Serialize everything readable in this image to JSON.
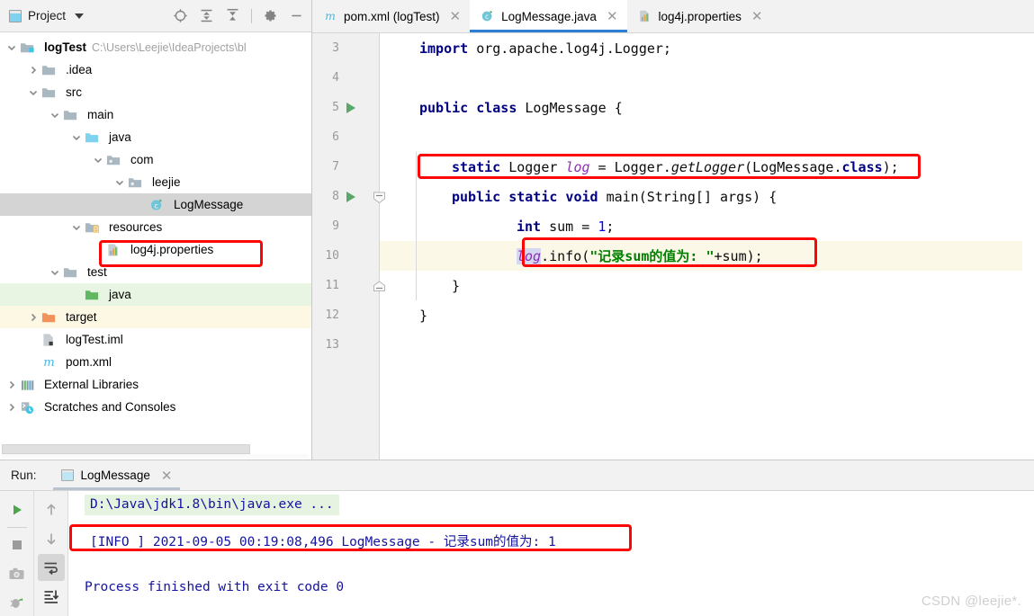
{
  "project_panel": {
    "title": "Project",
    "window_icon": "project-window-icon",
    "toolbar": [
      {
        "name": "locate-icon",
        "tooltip": "Select Opened File"
      },
      {
        "name": "expand-all-icon",
        "tooltip": "Expand All"
      },
      {
        "name": "collapse-all-icon",
        "tooltip": "Collapse All"
      },
      {
        "name": "settings-gear-icon",
        "tooltip": "Settings"
      },
      {
        "name": "hide-icon",
        "tooltip": "Hide"
      }
    ],
    "tree": [
      {
        "label": "logTest",
        "path": "C:\\Users\\Leejie\\IdeaProjects\\bl",
        "icon": "module-folder-icon",
        "arrow": "expanded",
        "depth": 0,
        "bold": true
      },
      {
        "label": ".idea",
        "path": "",
        "icon": "folder-icon",
        "arrow": "collapsed",
        "depth": 1,
        "bold": false
      },
      {
        "label": "src",
        "path": "",
        "icon": "folder-icon",
        "arrow": "expanded",
        "depth": 1,
        "bold": false
      },
      {
        "label": "main",
        "path": "",
        "icon": "folder-icon",
        "arrow": "expanded",
        "depth": 2,
        "bold": false
      },
      {
        "label": "java",
        "path": "",
        "icon": "source-root-folder-icon",
        "arrow": "expanded",
        "depth": 3,
        "bold": false
      },
      {
        "label": "com",
        "path": "",
        "icon": "package-icon",
        "arrow": "expanded",
        "depth": 4,
        "bold": false
      },
      {
        "label": "leejie",
        "path": "",
        "icon": "package-icon",
        "arrow": "expanded",
        "depth": 5,
        "bold": false
      },
      {
        "label": "LogMessage",
        "path": "",
        "icon": "java-class-icon",
        "arrow": "none",
        "depth": 6,
        "bold": false,
        "state": "selected"
      },
      {
        "label": "resources",
        "path": "",
        "icon": "resources-folder-icon",
        "arrow": "expanded",
        "depth": 3,
        "bold": false
      },
      {
        "label": "log4j.properties",
        "path": "",
        "icon": "properties-file-icon",
        "arrow": "none",
        "depth": 4,
        "bold": false,
        "state": "highlighted"
      },
      {
        "label": "test",
        "path": "",
        "icon": "folder-icon",
        "arrow": "expanded",
        "depth": 2,
        "bold": false
      },
      {
        "label": "java",
        "path": "",
        "icon": "test-source-folder-icon",
        "arrow": "none",
        "depth": 3,
        "bold": false,
        "state": "green"
      },
      {
        "label": "target",
        "path": "",
        "icon": "excluded-folder-icon",
        "arrow": "collapsed",
        "depth": 1,
        "bold": false,
        "state": "yellow"
      },
      {
        "label": "logTest.iml",
        "path": "",
        "icon": "iml-file-icon",
        "arrow": "none",
        "depth": 1,
        "bold": false
      },
      {
        "label": "pom.xml",
        "path": "",
        "icon": "maven-file-icon",
        "arrow": "none",
        "depth": 1,
        "bold": false
      },
      {
        "label": "External Libraries",
        "path": "",
        "icon": "libraries-icon",
        "arrow": "collapsed",
        "depth": 0,
        "bold": false
      },
      {
        "label": "Scratches and Consoles",
        "path": "",
        "icon": "scratches-icon",
        "arrow": "collapsed",
        "depth": 0,
        "bold": false
      }
    ]
  },
  "editor": {
    "tabs": [
      {
        "label": "pom.xml (logTest)",
        "icon": "maven-file-icon",
        "active": false,
        "closable": true
      },
      {
        "label": "LogMessage.java",
        "icon": "java-class-icon",
        "active": true,
        "closable": true
      },
      {
        "label": "log4j.properties",
        "icon": "properties-file-icon",
        "active": false,
        "closable": true
      }
    ],
    "lines": [
      {
        "num": "3",
        "gutter": "none",
        "current": false,
        "tokens": [
          {
            "t": "import ",
            "c": "kw"
          },
          {
            "t": "org.apache.log4j.Logger;",
            "c": "plain"
          }
        ],
        "indent": 4
      },
      {
        "num": "4",
        "gutter": "none",
        "current": false,
        "tokens": [],
        "indent": 0
      },
      {
        "num": "5",
        "gutter": "run",
        "current": false,
        "tokens": [
          {
            "t": "public class ",
            "c": "kw"
          },
          {
            "t": "LogMessage {",
            "c": "plain"
          }
        ],
        "indent": 4
      },
      {
        "num": "6",
        "gutter": "none",
        "current": false,
        "tokens": [],
        "indent": 0
      },
      {
        "num": "7",
        "gutter": "none",
        "current": false,
        "tokens": [
          {
            "t": "static ",
            "c": "kw"
          },
          {
            "t": "Logger ",
            "c": "plain"
          },
          {
            "t": "log",
            "c": "fld"
          },
          {
            "t": " = Logger.",
            "c": "plain"
          },
          {
            "t": "getLogger",
            "c": "mth"
          },
          {
            "t": "(LogMessage.",
            "c": "plain"
          },
          {
            "t": "class",
            "c": "kw"
          },
          {
            "t": ");",
            "c": "plain"
          }
        ],
        "indent": 8,
        "boxed": true
      },
      {
        "num": "8",
        "gutter": "run-fold",
        "current": false,
        "tokens": [
          {
            "t": "public static void ",
            "c": "kw"
          },
          {
            "t": "main(String[] args) {",
            "c": "plain"
          }
        ],
        "indent": 8
      },
      {
        "num": "9",
        "gutter": "none",
        "current": false,
        "tokens": [
          {
            "t": "int ",
            "c": "kw"
          },
          {
            "t": "sum = ",
            "c": "plain"
          },
          {
            "t": "1",
            "c": "num"
          },
          {
            "t": ";",
            "c": "plain"
          }
        ],
        "indent": 16
      },
      {
        "num": "10",
        "gutter": "none",
        "current": true,
        "tokens": [
          {
            "t": "log",
            "c": "fld-sel"
          },
          {
            "t": ".info(",
            "c": "plain"
          },
          {
            "t": "\"记录sum的值为: \"",
            "c": "str"
          },
          {
            "t": "+sum);",
            "c": "plain"
          }
        ],
        "indent": 16,
        "boxed": true
      },
      {
        "num": "11",
        "gutter": "fold",
        "current": false,
        "tokens": [
          {
            "t": "}",
            "c": "plain"
          }
        ],
        "indent": 8
      },
      {
        "num": "12",
        "gutter": "none",
        "current": false,
        "tokens": [
          {
            "t": "}",
            "c": "plain"
          }
        ],
        "indent": 4
      },
      {
        "num": "13",
        "gutter": "none",
        "current": false,
        "tokens": [],
        "indent": 0
      }
    ]
  },
  "run_panel": {
    "run_label": "Run:",
    "tab_label": "LogMessage",
    "tab_icon": "run-config-icon",
    "side_buttons": [
      {
        "name": "rerun-button",
        "icon": "play-icon",
        "active": false
      },
      {
        "name": "stop-button",
        "icon": "stop-square-icon",
        "active": false
      },
      {
        "name": "screenshot-button",
        "icon": "camera-icon",
        "active": false
      },
      {
        "name": "debug-button",
        "icon": "bug-icon",
        "active": false
      },
      {
        "name": "prev-occurrence-button",
        "icon": "arrow-up-icon",
        "active": false
      },
      {
        "name": "next-occurrence-button",
        "icon": "arrow-down-icon",
        "active": false
      },
      {
        "name": "soft-wrap-button",
        "icon": "soft-wrap-icon",
        "active": true
      },
      {
        "name": "scroll-to-end-button",
        "icon": "scroll-to-end-icon",
        "active": false
      }
    ],
    "console": {
      "command_line": "D:\\Java\\jdk1.8\\bin\\java.exe ...",
      "log_line": "[INFO ] 2021-09-05 00:19:08,496 LogMessage - 记录sum的值为: 1",
      "exit_line": "Process finished with exit code 0"
    }
  },
  "watermark": "CSDN @leejie*.",
  "colors": {
    "highlight_box": "#fb0505",
    "tab_active_underline": "#2d7fd6",
    "keyword": "#000080",
    "string": "#008000",
    "field": "#8b2fb4",
    "number": "#0000ff",
    "console_text": "#14149e",
    "current_line_bg": "#fcf8e8",
    "selected_tree_bg": "#d4d4d4"
  }
}
